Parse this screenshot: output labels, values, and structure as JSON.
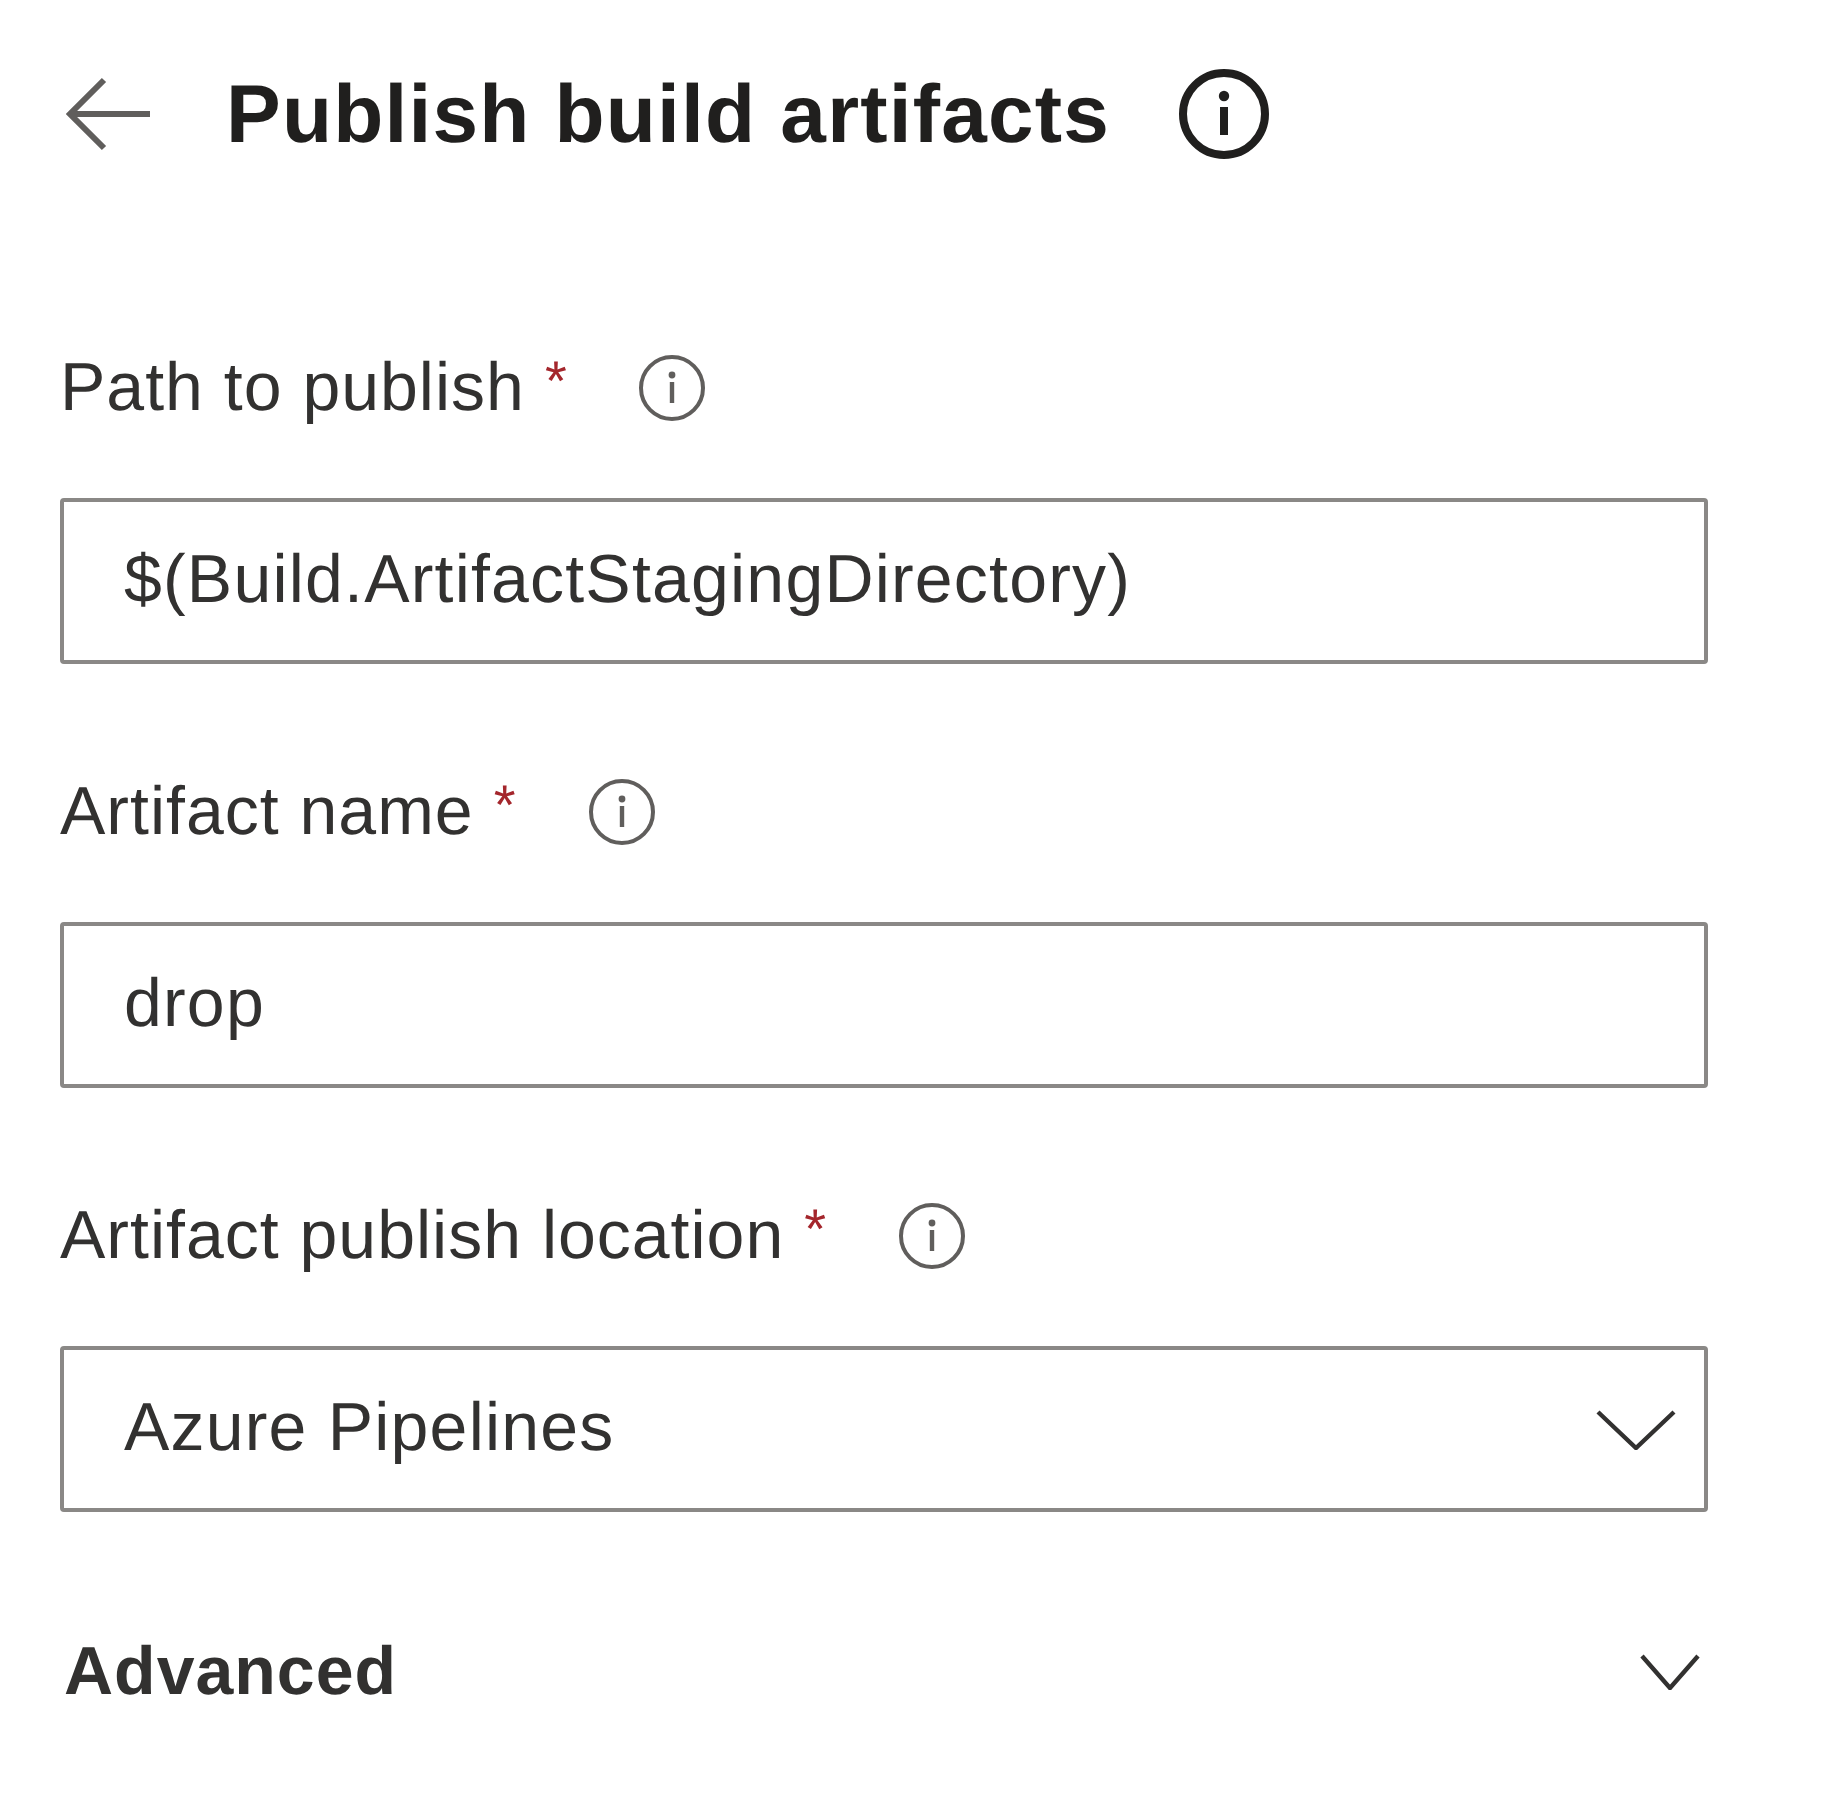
{
  "header": {
    "title": "Publish build artifacts"
  },
  "fields": [
    {
      "kind": "text",
      "label": "Path to publish",
      "required_mark": "*",
      "value": "$(Build.ArtifactStagingDirectory)"
    },
    {
      "kind": "text",
      "label": "Artifact name",
      "required_mark": "*",
      "value": "drop"
    },
    {
      "kind": "dropdown",
      "label": "Artifact publish location",
      "required_mark": "*",
      "value": "Azure Pipelines"
    }
  ],
  "advanced_section": {
    "title": "Advanced",
    "expanded": false
  }
}
